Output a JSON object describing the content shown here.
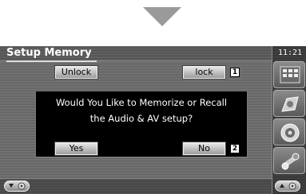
{
  "screen": {
    "title": "Setup Memory",
    "clock": "11:21"
  },
  "top_buttons": {
    "unlock_label": "Unlock",
    "lock_label": "lock"
  },
  "dialog": {
    "line1": "Would You Like to Memorize or Recall",
    "line2": "the Audio & AV setup?",
    "yes_label": "Yes",
    "no_label": "No"
  },
  "callouts": {
    "lock_callout": "1",
    "no_callout": "2"
  },
  "side_menu": {
    "items": [
      {
        "icon": "grid-menu-icon"
      },
      {
        "icon": "media-source-icon"
      },
      {
        "icon": "speaker-icon"
      },
      {
        "icon": "setup-tools-icon"
      }
    ]
  },
  "colors": {
    "screen_background": "#6c6c6c",
    "dialog_background": "#000000",
    "button_face": "#c8c8c8"
  }
}
